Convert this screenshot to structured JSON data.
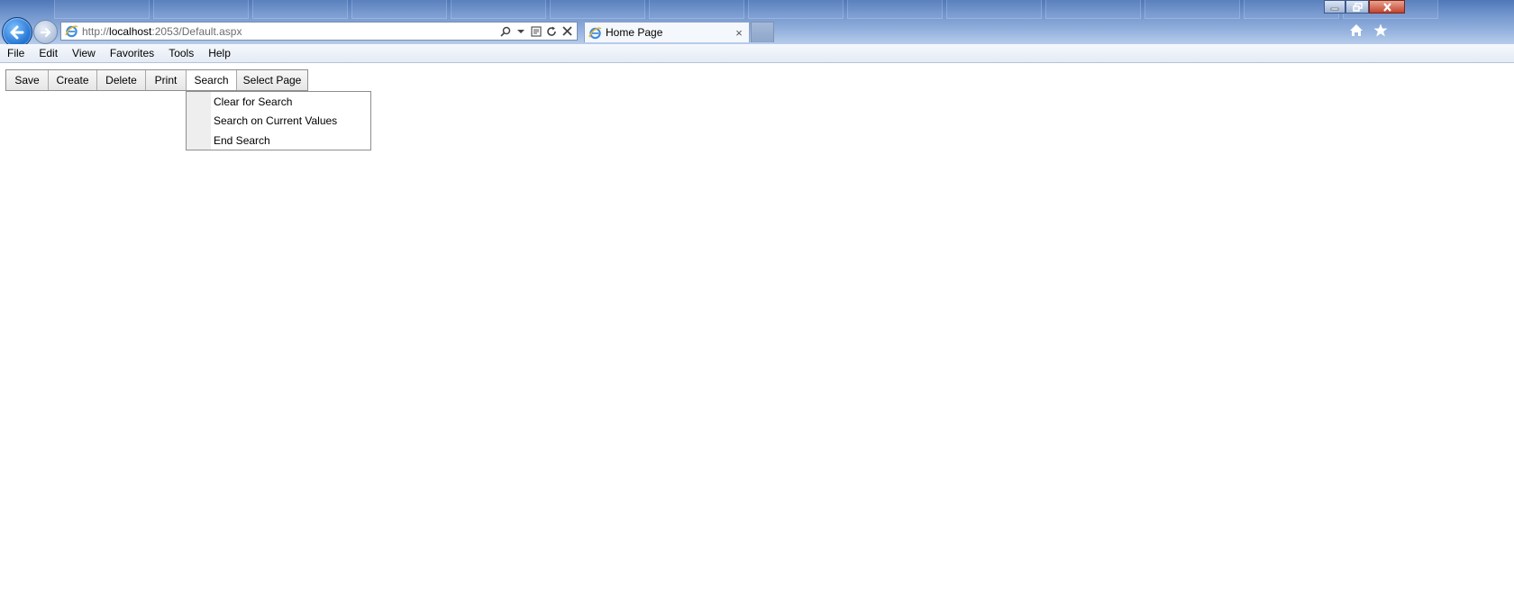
{
  "browser": {
    "address_url_prefix": "http://",
    "address_url_host": "localhost",
    "address_url_rest": ":2053/Default.aspx",
    "tab_title": "Home Page",
    "tab_close_glyph": "×",
    "accent_color": "#1d6fd1"
  },
  "menubar": {
    "items": [
      "File",
      "Edit",
      "View",
      "Favorites",
      "Tools",
      "Help"
    ]
  },
  "toolbar": {
    "buttons": [
      "Save",
      "Create",
      "Delete",
      "Print",
      "Search",
      "Select Page"
    ],
    "active": "Search"
  },
  "search_menu": {
    "items": [
      "Clear for Search",
      "Search on Current Values",
      "End Search"
    ]
  },
  "icons": {
    "back": "back-arrow-icon",
    "forward": "forward-arrow-icon",
    "page": "ie-page-icon",
    "home": "home-icon",
    "favorites": "star-icon"
  }
}
